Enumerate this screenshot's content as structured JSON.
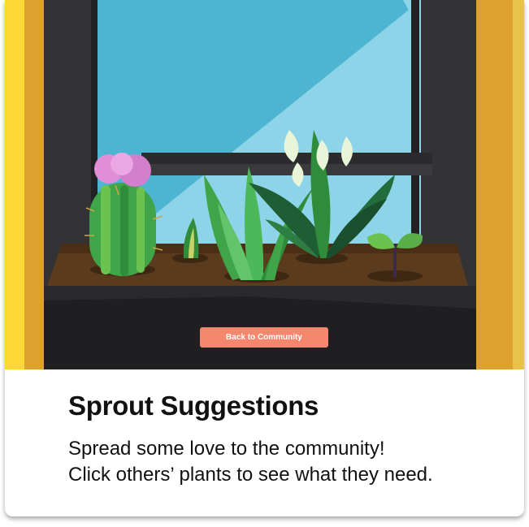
{
  "scene": {
    "back_button_label": "Back to Community"
  },
  "caption": {
    "title": "Sprout Suggestions",
    "line1": "Spread some love to the community!",
    "line2": "Click others’ plants to see what they need."
  },
  "colors": {
    "button": "#f4876e",
    "frame_yellow": "#fdd835",
    "frame_orange": "#dfa12e",
    "wall_dark": "#333336",
    "sky": "#4db5d1",
    "soil": "#5b3b1d"
  }
}
